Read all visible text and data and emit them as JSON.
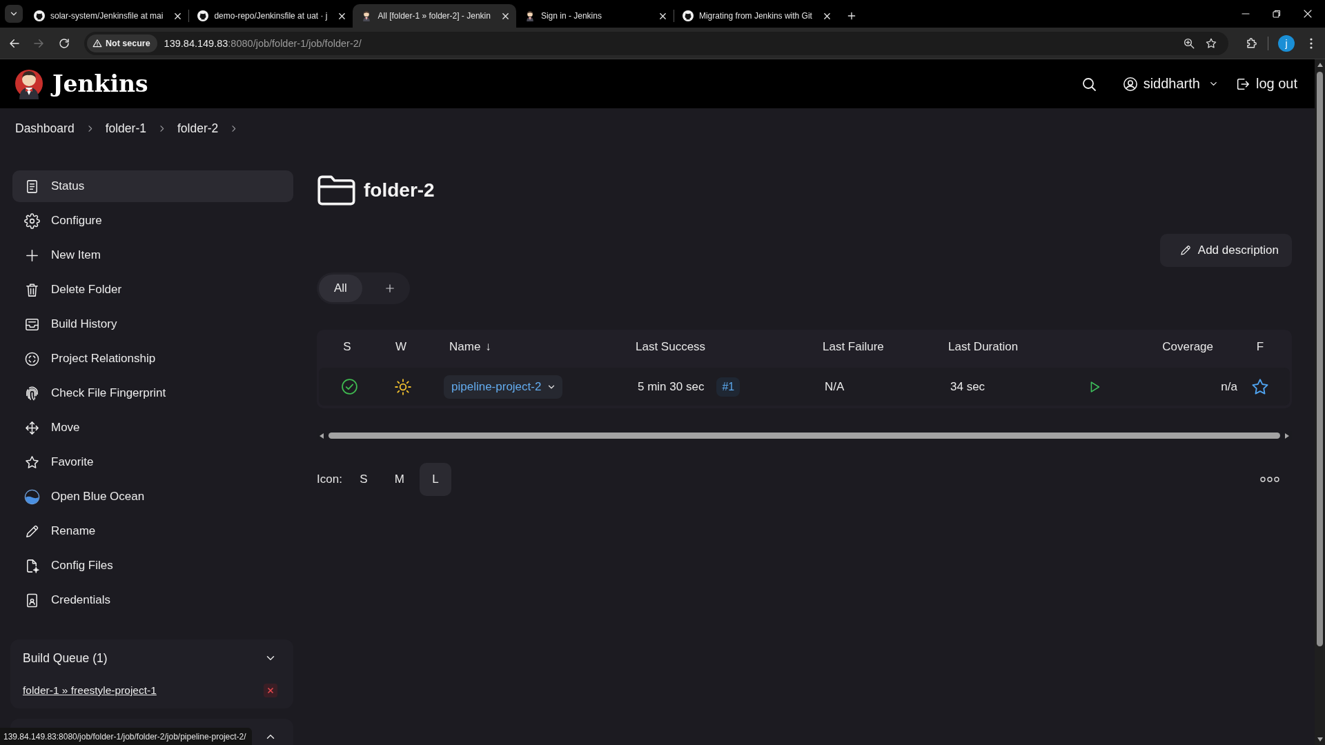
{
  "browser": {
    "tabs": [
      {
        "title": "solar-system/Jenkinsfile at mai",
        "selected": false
      },
      {
        "title": "demo-repo/Jenkinsfile at uat · j",
        "selected": false
      },
      {
        "title": "All [folder-1 » folder-2] - Jenkin",
        "selected": true
      },
      {
        "title": "Sign in - Jenkins",
        "selected": false
      },
      {
        "title": "Migrating from Jenkins with Git",
        "selected": false
      }
    ],
    "forward_disabled": true,
    "address": {
      "security": "Not secure",
      "host": "139.84.149.83",
      "path": ":8080/job/folder-1/job/folder-2/"
    },
    "profile_initial": "j"
  },
  "header": {
    "brand": "Jenkins",
    "user": "siddharth",
    "logout": "log out"
  },
  "breadcrumbs": [
    {
      "label": "Dashboard"
    },
    {
      "label": "folder-1"
    },
    {
      "label": "folder-2"
    }
  ],
  "sidebar": {
    "items": [
      {
        "label": "Status",
        "selected": true
      },
      {
        "label": "Configure",
        "selected": false
      },
      {
        "label": "New Item",
        "selected": false
      },
      {
        "label": "Delete Folder",
        "selected": false
      },
      {
        "label": "Build History",
        "selected": false
      },
      {
        "label": "Project Relationship",
        "selected": false
      },
      {
        "label": "Check File Fingerprint",
        "selected": false
      },
      {
        "label": "Move",
        "selected": false
      },
      {
        "label": "Favorite",
        "selected": false
      },
      {
        "label": "Open Blue Ocean",
        "selected": false
      },
      {
        "label": "Rename",
        "selected": false
      },
      {
        "label": "Config Files",
        "selected": false
      },
      {
        "label": "Credentials",
        "selected": false
      }
    ],
    "build_queue": {
      "title": "Build Queue (1)",
      "expanded": true,
      "items": [
        {
          "label": "folder-1 » freestyle-project-1"
        }
      ]
    }
  },
  "main": {
    "title": "folder-2",
    "add_description": "Add description",
    "views": [
      {
        "label": "All",
        "selected": true
      }
    ],
    "table": {
      "columns": [
        {
          "kind": "status",
          "label": "S"
        },
        {
          "kind": "weather",
          "label": "W"
        },
        {
          "kind": "name",
          "label": "Name",
          "sort": "↓"
        },
        {
          "kind": "last_success",
          "label": "Last Success"
        },
        {
          "kind": "last_failure",
          "label": "Last Failure"
        },
        {
          "kind": "last_duration",
          "label": "Last Duration"
        },
        {
          "kind": "build"
        },
        {
          "kind": "coverage",
          "label": "Coverage"
        },
        {
          "kind": "favorite",
          "label": "F"
        }
      ],
      "rows": [
        {
          "name": "pipeline-project-2",
          "last_success": "5 min 30 sec",
          "last_success_build": "#1",
          "last_failure": "N/A",
          "last_duration": "34 sec",
          "coverage": "n/a",
          "favorite": false
        }
      ]
    },
    "icon_size": {
      "label": "Icon:",
      "options": [
        {
          "label": "S",
          "selected": false
        },
        {
          "label": "M",
          "selected": false
        },
        {
          "label": "L",
          "selected": true
        }
      ]
    }
  },
  "status_bar": {
    "url": "139.84.149.83:8080/job/folder-1/job/folder-2/job/pipeline-project-2/"
  }
}
